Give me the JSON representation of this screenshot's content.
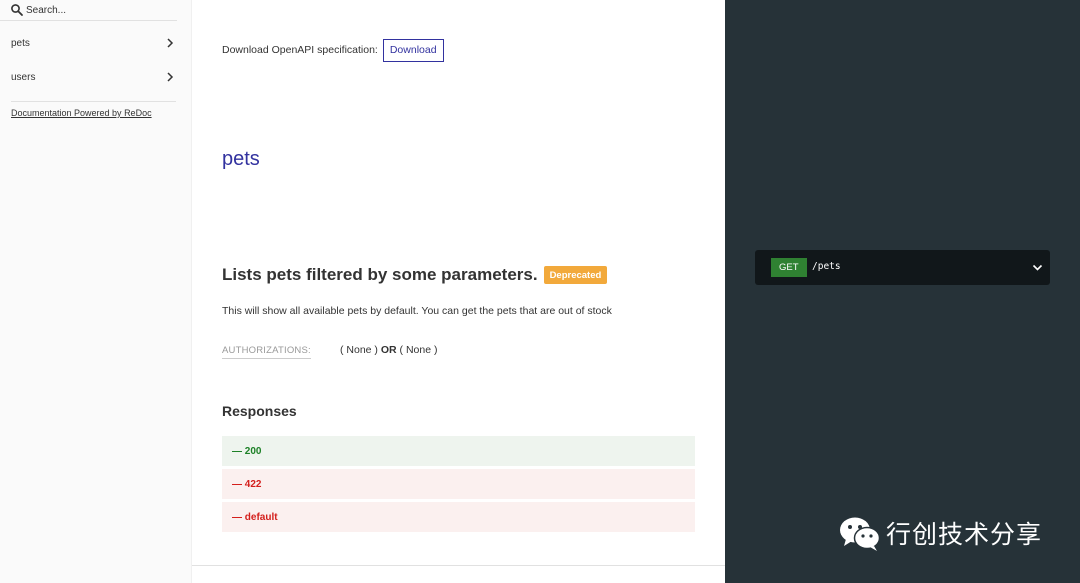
{
  "sidebar": {
    "search": {
      "placeholder": "Search...",
      "value": "",
      "icon": "search-icon"
    },
    "items": [
      {
        "label": "pets",
        "icon": "chevron-right-icon"
      },
      {
        "label": "users",
        "icon": "chevron-right-icon"
      }
    ],
    "powered_by": "Documentation Powered by ReDoc"
  },
  "content": {
    "download_text": "Download OpenAPI specification:",
    "download_button": "Download",
    "section_title": "pets",
    "operation": {
      "title": "Lists pets filtered by some parameters.",
      "badge": "Deprecated",
      "description": "This will show all available pets by default. You can get the pets that are out of stock",
      "authorizations_label": "AUTHORIZATIONS:",
      "auth_option_1": "( None )",
      "auth_or": "OR",
      "auth_option_2": "( None )"
    },
    "responses_title": "Responses",
    "responses": [
      {
        "label": "— 200"
      },
      {
        "label": "— 422"
      },
      {
        "label": "— default"
      }
    ]
  },
  "right_panel": {
    "method": "GET",
    "path": "/pets",
    "icon": "chevron-down-icon"
  },
  "watermark": {
    "text": "行创技术分享",
    "icon": "wechat-icon"
  },
  "colors": {
    "accent": "#32329f",
    "deprecated": "#f2a93b",
    "success": "#1d8127",
    "error": "#d41f1c",
    "dark_panel": "#263238",
    "method_get": "#2f8132"
  }
}
